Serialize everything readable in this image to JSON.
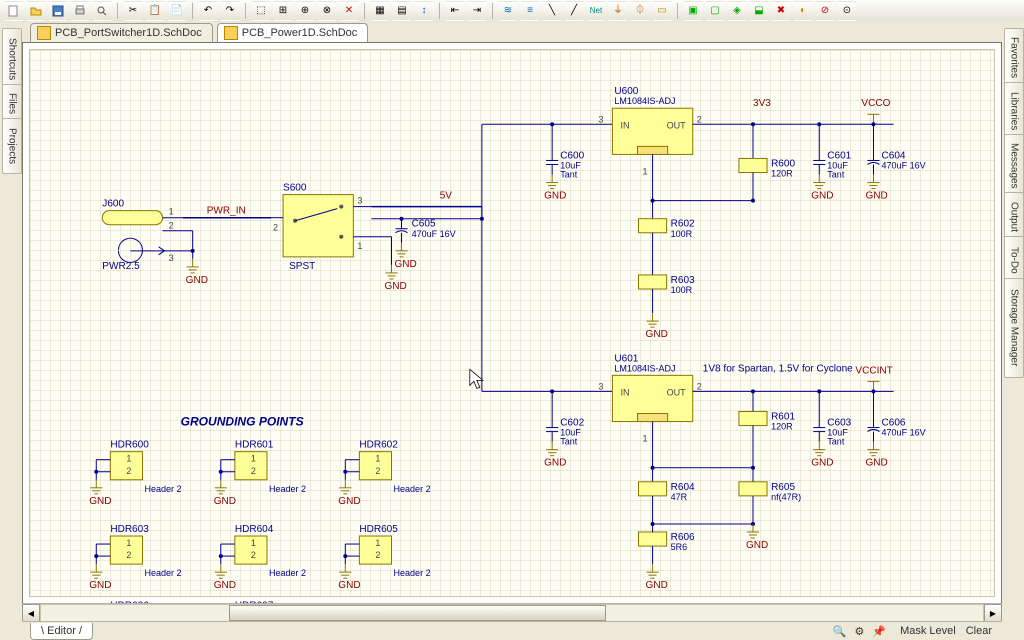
{
  "tabs": {
    "t1": "PCB_PortSwitcher1D.SchDoc",
    "t2": "PCB_Power1D.SchDoc"
  },
  "rails": {
    "left": [
      "Shortcuts",
      "Files",
      "Projects"
    ],
    "right": [
      "Favorites",
      "Libraries",
      "Messages",
      "Output",
      "To-Do",
      "Storage Manager"
    ]
  },
  "status": {
    "editor": "Editor",
    "mask": "Mask Level",
    "clear": "Clear"
  },
  "nets": {
    "pwr_in": "PWR_IN",
    "v5": "5V",
    "v3v3": "3V3",
    "vcco": "VCCO",
    "vccint": "VCCINT",
    "note1v8": "1V8 for Spartan, 1.5V for Cyclone",
    "gnd": "GND"
  },
  "title_grounding": "GROUNDING POINTS",
  "parts": {
    "J600": {
      "ref": "J600",
      "val": "PWR2.5"
    },
    "S600": {
      "ref": "S600",
      "val": "SPST"
    },
    "C605": {
      "ref": "C605",
      "val": "470uF 16V"
    },
    "U600": {
      "ref": "U600",
      "val": "LM1084IS-ADJ",
      "pin_in": "IN",
      "pin_out": "OUT"
    },
    "U601": {
      "ref": "U601",
      "val": "LM1084IS-ADJ",
      "pin_in": "IN",
      "pin_out": "OUT"
    },
    "C600": {
      "ref": "C600",
      "val1": "10uF",
      "val2": "Tant"
    },
    "C601": {
      "ref": "C601",
      "val1": "10uF",
      "val2": "Tant"
    },
    "C602": {
      "ref": "C602",
      "val1": "10uF",
      "val2": "Tant"
    },
    "C603": {
      "ref": "C603",
      "val1": "10uF",
      "val2": "Tant"
    },
    "C604": {
      "ref": "C604",
      "val": "470uF 16V"
    },
    "C606": {
      "ref": "C606",
      "val": "470uF 16V"
    },
    "R600": {
      "ref": "R600",
      "val": "120R"
    },
    "R601": {
      "ref": "R601",
      "val": "120R"
    },
    "R602": {
      "ref": "R602",
      "val": "100R"
    },
    "R603": {
      "ref": "R603",
      "val": "100R"
    },
    "R604": {
      "ref": "R604",
      "val": "47R"
    },
    "R605": {
      "ref": "R605",
      "val": "nf(47R)"
    },
    "R606": {
      "ref": "R606",
      "val": "5R6"
    }
  },
  "headers": {
    "HDR600": "Header 2",
    "HDR601": "Header 2",
    "HDR602": "Header 2",
    "HDR603": "Header 2",
    "HDR604": "Header 2",
    "HDR605": "Header 2",
    "HDR606": "",
    "HDR607": ""
  },
  "hdr_pins": {
    "p1": "1",
    "p2": "2"
  }
}
